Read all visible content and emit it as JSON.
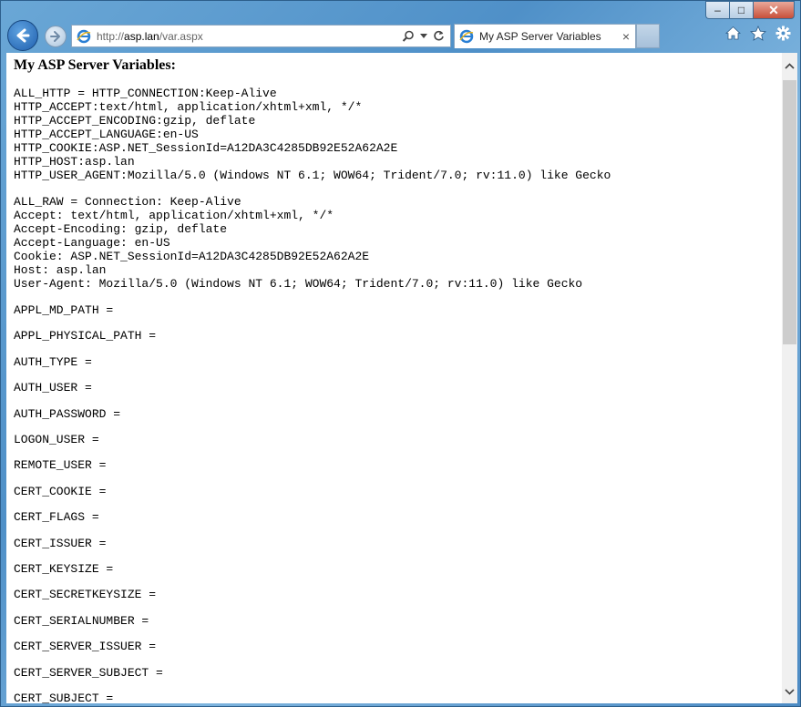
{
  "window": {
    "caption": {
      "minimize": "–",
      "maximize": "□",
      "close": "✕"
    }
  },
  "navbar": {
    "url_scheme": "http://",
    "url_host": "asp.lan",
    "url_path": "/var.aspx",
    "tab_title": "My ASP Server Variables",
    "tab_close": "×"
  },
  "page": {
    "heading": "My ASP Server Variables:",
    "all_http": [
      "ALL_HTTP = HTTP_CONNECTION:Keep-Alive",
      "HTTP_ACCEPT:text/html, application/xhtml+xml, */*",
      "HTTP_ACCEPT_ENCODING:gzip, deflate",
      "HTTP_ACCEPT_LANGUAGE:en-US",
      "HTTP_COOKIE:ASP.NET_SessionId=A12DA3C4285DB92E52A62A2E",
      "HTTP_HOST:asp.lan",
      "HTTP_USER_AGENT:Mozilla/5.0 (Windows NT 6.1; WOW64; Trident/7.0; rv:11.0) like Gecko"
    ],
    "all_raw": [
      "ALL_RAW = Connection: Keep-Alive",
      "Accept: text/html, application/xhtml+xml, */*",
      "Accept-Encoding: gzip, deflate",
      "Accept-Language: en-US",
      "Cookie: ASP.NET_SessionId=A12DA3C4285DB92E52A62A2E",
      "Host: asp.lan",
      "User-Agent: Mozilla/5.0 (Windows NT 6.1; WOW64; Trident/7.0; rv:11.0) like Gecko"
    ],
    "vars": [
      "APPL_MD_PATH =",
      "APPL_PHYSICAL_PATH =",
      "AUTH_TYPE =",
      "AUTH_USER =",
      "AUTH_PASSWORD =",
      "LOGON_USER =",
      "REMOTE_USER =",
      "CERT_COOKIE =",
      "CERT_FLAGS =",
      "CERT_ISSUER =",
      "CERT_KEYSIZE =",
      "CERT_SECRETKEYSIZE =",
      "CERT_SERIALNUMBER =",
      "CERT_SERVER_ISSUER =",
      "CERT_SERVER_SUBJECT =",
      "CERT_SUBJECT ="
    ]
  },
  "colors": {
    "titlebar": "#4f90c8",
    "back_button": "#1f5fae",
    "close_button": "#c7503a"
  }
}
